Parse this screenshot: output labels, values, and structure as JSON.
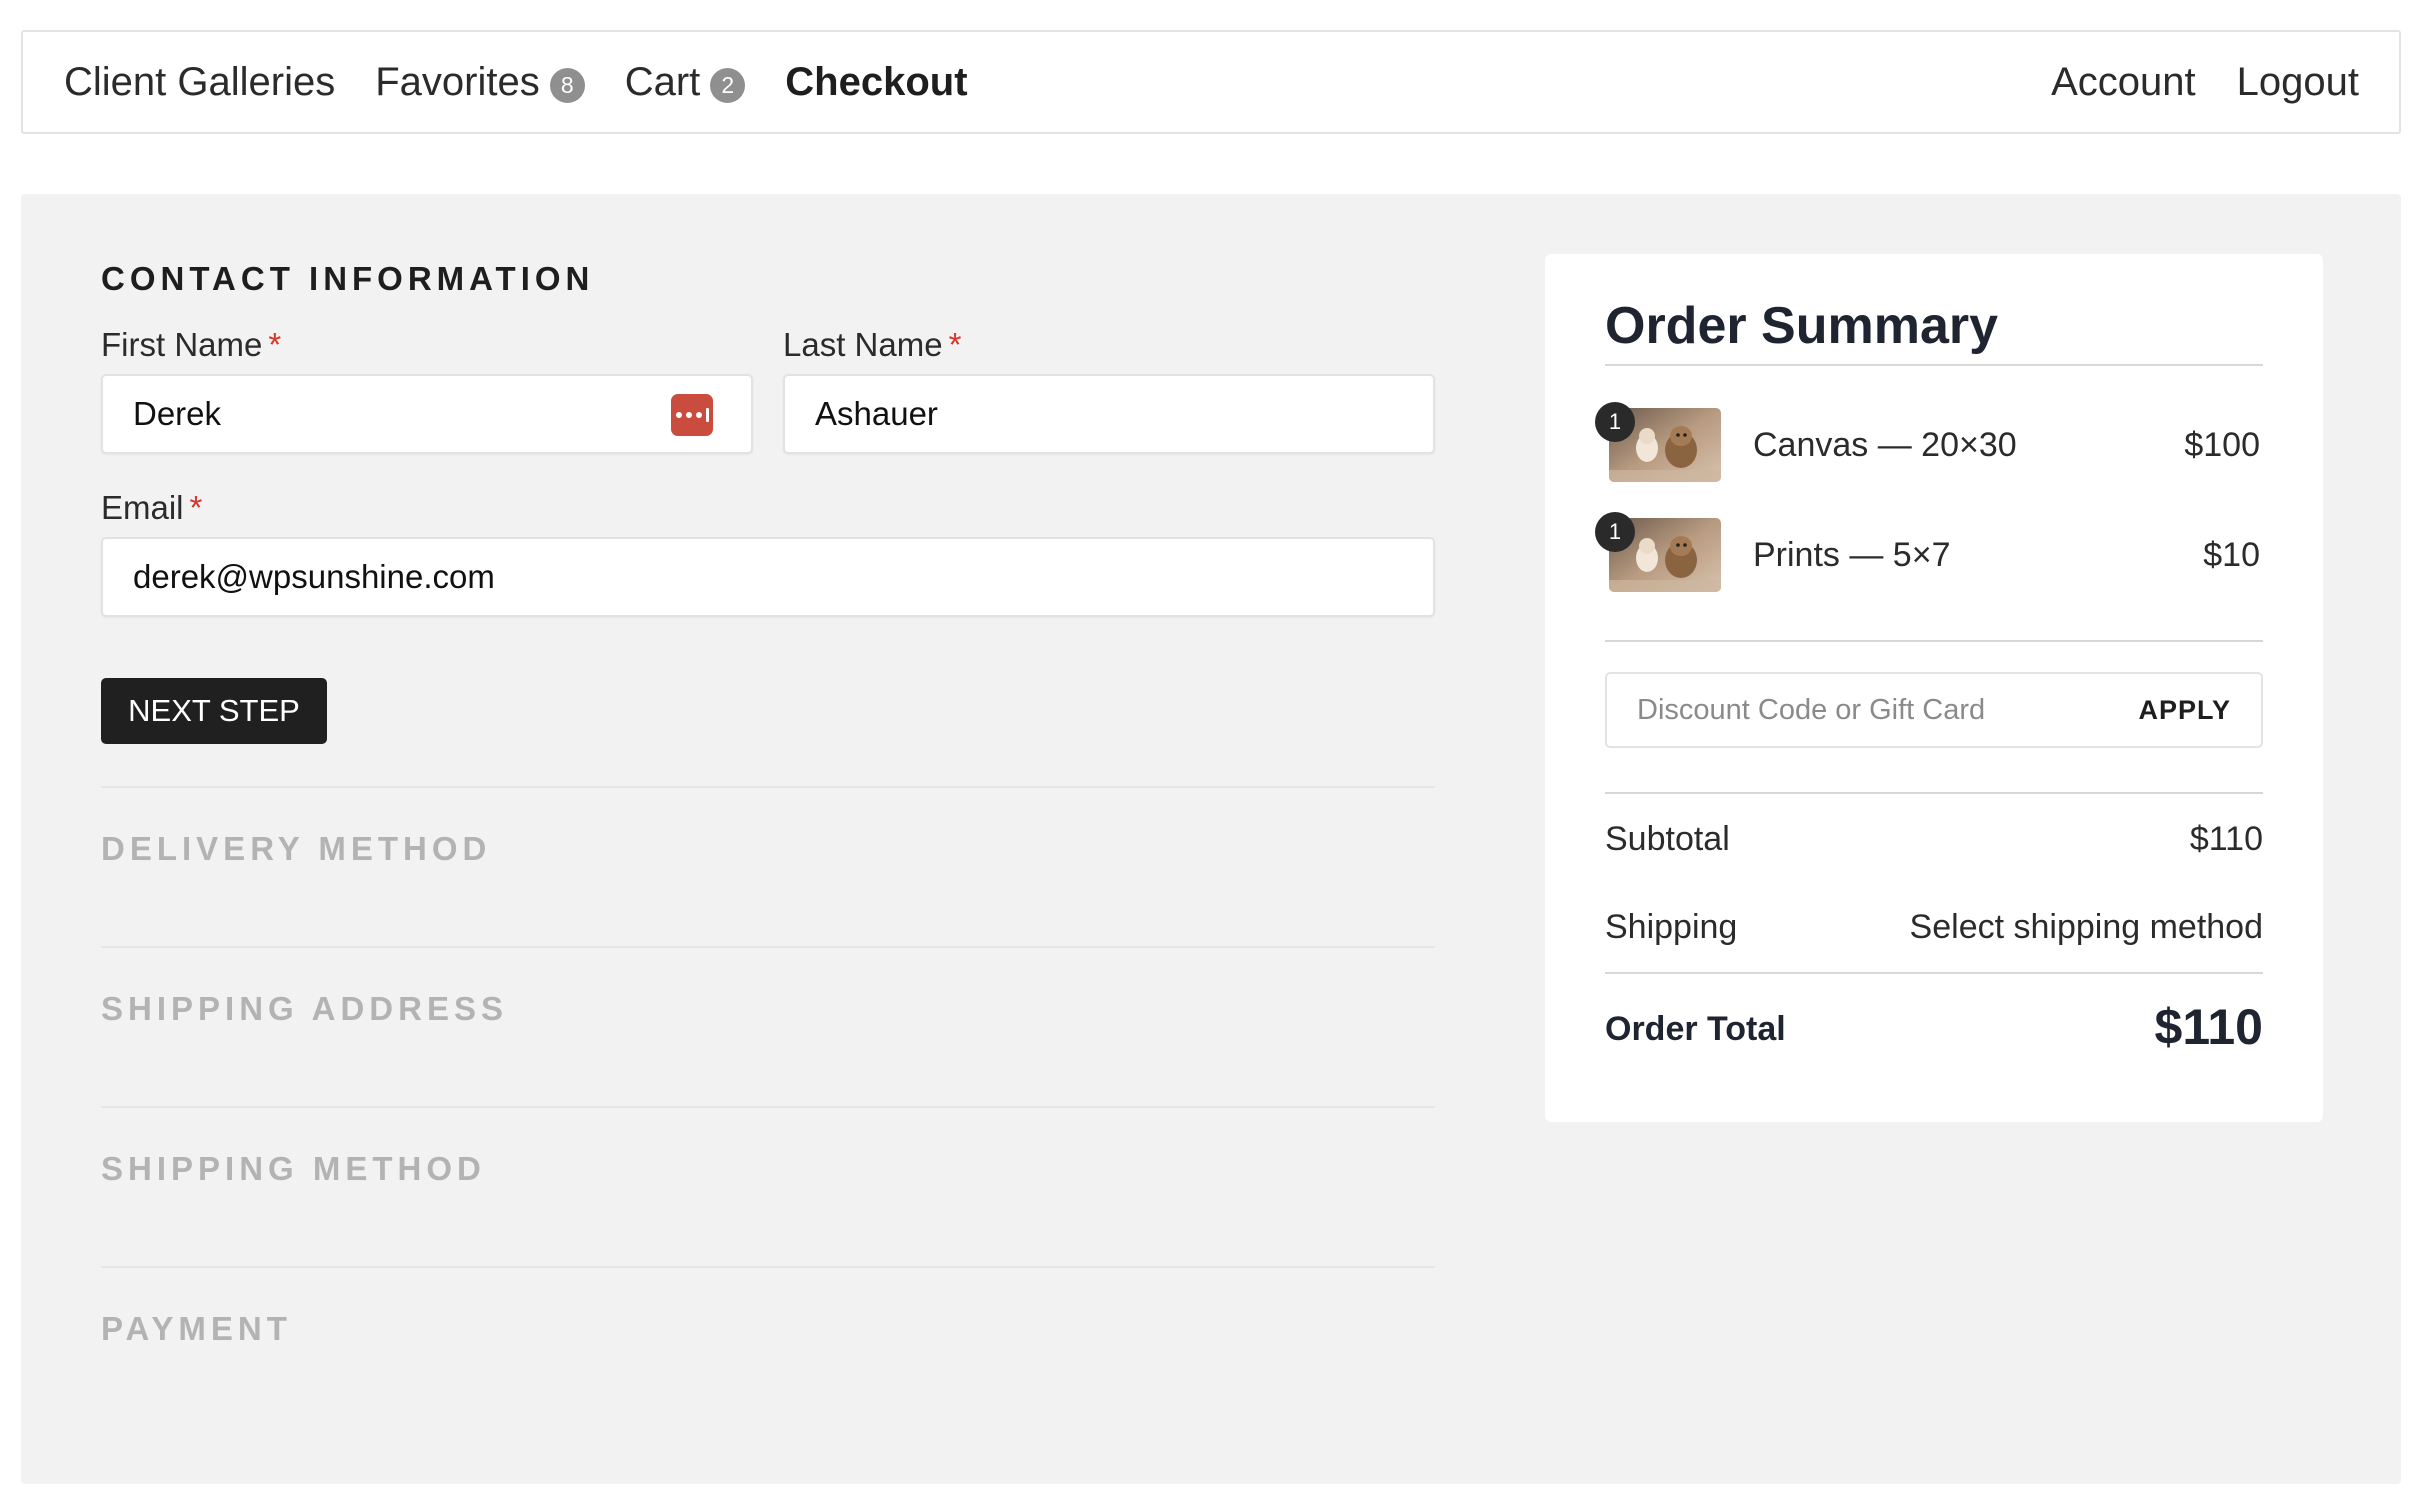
{
  "nav": {
    "left": [
      {
        "label": "Client Galleries",
        "badge": null
      },
      {
        "label": "Favorites",
        "badge": "8"
      },
      {
        "label": "Cart",
        "badge": "2"
      },
      {
        "label": "Checkout",
        "badge": null,
        "active": true
      }
    ],
    "right": [
      {
        "label": "Account"
      },
      {
        "label": "Logout"
      }
    ]
  },
  "contact": {
    "title": "CONTACT INFORMATION",
    "first_name": {
      "label": "First Name",
      "required_mark": "*",
      "value": "Derek"
    },
    "last_name": {
      "label": "Last Name",
      "required_mark": "*",
      "value": "Ashauer"
    },
    "email": {
      "label": "Email",
      "required_mark": "*",
      "value": "derek@wpsunshine.com"
    },
    "next_button": "NEXT STEP"
  },
  "steps": [
    {
      "title": "DELIVERY METHOD"
    },
    {
      "title": "SHIPPING ADDRESS"
    },
    {
      "title": "SHIPPING METHOD"
    },
    {
      "title": "PAYMENT"
    }
  ],
  "summary": {
    "title": "Order Summary",
    "items": [
      {
        "qty": "1",
        "name": "Canvas — 20×30",
        "price": "$100"
      },
      {
        "qty": "1",
        "name": "Prints — 5×7",
        "price": "$10"
      }
    ],
    "discount": {
      "placeholder": "Discount Code or Gift Card",
      "apply_label": "APPLY"
    },
    "subtotal": {
      "label": "Subtotal",
      "value": "$110"
    },
    "shipping": {
      "label": "Shipping",
      "value": "Select shipping method"
    },
    "total": {
      "label": "Order Total",
      "value": "$110"
    }
  },
  "colors": {
    "required": "#d7342a",
    "button": "#202020",
    "panel_bg": "#f2f2f2",
    "pending_step": "#b3b3b3",
    "password_icon": "#c94c3f"
  }
}
